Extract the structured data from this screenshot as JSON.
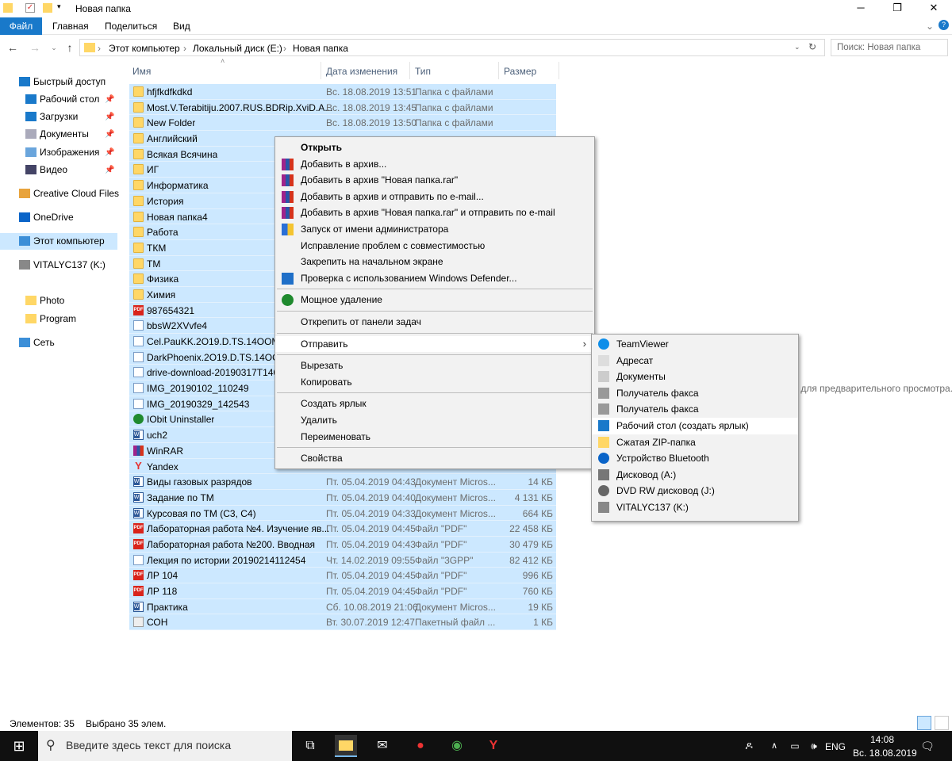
{
  "window": {
    "title": "Новая папка",
    "minimize": "─",
    "maximize": "❐",
    "close": "✕"
  },
  "ribbon": {
    "tabs": [
      "Файл",
      "Главная",
      "Поделиться",
      "Вид"
    ]
  },
  "address": {
    "crumbs": [
      "Этот компьютер",
      "Локальный диск (E:)",
      "Новая папка"
    ],
    "search_placeholder": "Поиск: Новая папка"
  },
  "sidebar": {
    "items": [
      {
        "label": "Быстрый доступ",
        "icon": "star-icon"
      },
      {
        "label": "Рабочий стол",
        "icon": "desktop-icon",
        "pinned": true
      },
      {
        "label": "Загрузки",
        "icon": "download-icon",
        "pinned": true
      },
      {
        "label": "Документы",
        "icon": "documents-icon",
        "pinned": true
      },
      {
        "label": "Изображения",
        "icon": "pictures-icon",
        "pinned": true
      },
      {
        "label": "Видео",
        "icon": "video-icon",
        "pinned": true
      },
      {
        "label": "Creative Cloud Files",
        "icon": "creative-cloud-icon"
      },
      {
        "label": "OneDrive",
        "icon": "onedrive-icon"
      },
      {
        "label": "Этот компьютер",
        "icon": "computer-icon",
        "selected": true
      },
      {
        "label": "VITALYC137 (K:)",
        "icon": "usb-drive-icon"
      },
      {
        "label": "Photo",
        "icon": "folder-icon"
      },
      {
        "label": "Program",
        "icon": "folder-icon"
      },
      {
        "label": "Сеть",
        "icon": "network-icon"
      }
    ]
  },
  "columns": {
    "name": "Имя",
    "date": "Дата изменения",
    "type": "Тип",
    "size": "Размер"
  },
  "files": [
    {
      "name": "hfjfkdfkdkd",
      "date": "Вс. 18.08.2019 13:51",
      "type": "Папка с файлами",
      "size": "",
      "icon": "folder"
    },
    {
      "name": "Most.V.Terabitiju.2007.RUS.BDRip.XviD.A...",
      "date": "Вс. 18.08.2019 13:45",
      "type": "Папка с файлами",
      "size": "",
      "icon": "folder"
    },
    {
      "name": "New Folder",
      "date": "Вс. 18.08.2019 13:50",
      "type": "Папка с файлами",
      "size": "",
      "icon": "folder"
    },
    {
      "name": "Английский",
      "date": "",
      "type": "",
      "size": "",
      "icon": "folder"
    },
    {
      "name": "Всякая Всячина",
      "date": "",
      "type": "",
      "size": "",
      "icon": "folder"
    },
    {
      "name": "ИГ",
      "date": "",
      "type": "",
      "size": "",
      "icon": "folder"
    },
    {
      "name": "Информатика",
      "date": "",
      "type": "",
      "size": "",
      "icon": "folder"
    },
    {
      "name": "История",
      "date": "",
      "type": "",
      "size": "",
      "icon": "folder"
    },
    {
      "name": "Новая папка4",
      "date": "",
      "type": "",
      "size": "",
      "icon": "folder"
    },
    {
      "name": "Работа",
      "date": "",
      "type": "",
      "size": "",
      "icon": "folder"
    },
    {
      "name": "ТКМ",
      "date": "",
      "type": "",
      "size": "",
      "icon": "folder"
    },
    {
      "name": "ТМ",
      "date": "",
      "type": "",
      "size": "",
      "icon": "folder"
    },
    {
      "name": "Физика",
      "date": "",
      "type": "",
      "size": "",
      "icon": "folder"
    },
    {
      "name": "Химия",
      "date": "",
      "type": "",
      "size": "",
      "icon": "folder"
    },
    {
      "name": "987654321",
      "date": "",
      "type": "",
      "size": "",
      "icon": "pdf"
    },
    {
      "name": "bbsW2XVvfe4",
      "date": "",
      "type": "",
      "size": "",
      "icon": "doc"
    },
    {
      "name": "Cel.PauKK.2O19.D.TS.14OOMB",
      "date": "",
      "type": "",
      "size": "",
      "icon": "doc"
    },
    {
      "name": "DarkPhoenix.2O19.D.TS.14OOMB",
      "date": "",
      "type": "",
      "size": "",
      "icon": "doc"
    },
    {
      "name": "drive-download-20190317T140600",
      "date": "",
      "type": "",
      "size": "",
      "icon": "doc"
    },
    {
      "name": "IMG_20190102_110249",
      "date": "",
      "type": "",
      "size": "",
      "icon": "doc"
    },
    {
      "name": "IMG_20190329_142543",
      "date": "",
      "type": "",
      "size": "",
      "icon": "doc"
    },
    {
      "name": "IObit Uninstaller",
      "date": "",
      "type": "",
      "size": "",
      "icon": "iobit"
    },
    {
      "name": "uch2",
      "date": "",
      "type": "",
      "size": "",
      "icon": "word"
    },
    {
      "name": "WinRAR",
      "date": "",
      "type": "",
      "size": "",
      "icon": "rar"
    },
    {
      "name": "Yandex",
      "date": "",
      "type": "",
      "size": "",
      "icon": "yandex"
    },
    {
      "name": "Виды газовых разрядов",
      "date": "Пт. 05.04.2019 04:43",
      "type": "Документ Micros...",
      "size": "14 КБ",
      "icon": "word"
    },
    {
      "name": "Задание по ТМ",
      "date": "Пт. 05.04.2019 04:40",
      "type": "Документ Micros...",
      "size": "4 131 КБ",
      "icon": "word"
    },
    {
      "name": "Курсовая по ТМ (С3, С4)",
      "date": "Пт. 05.04.2019 04:33",
      "type": "Документ Micros...",
      "size": "664 КБ",
      "icon": "word"
    },
    {
      "name": "Лабораторная работа №4. Изучение яв...",
      "date": "Пт. 05.04.2019 04:45",
      "type": "Файл \"PDF\"",
      "size": "22 458 КБ",
      "icon": "pdf"
    },
    {
      "name": "Лабораторная работа №200. Вводная",
      "date": "Пт. 05.04.2019 04:43",
      "type": "Файл \"PDF\"",
      "size": "30 479 КБ",
      "icon": "pdf"
    },
    {
      "name": "Лекция по истории 20190214112454",
      "date": "Чт. 14.02.2019 09:55",
      "type": "Файл \"3GPP\"",
      "size": "82 412 КБ",
      "icon": "doc"
    },
    {
      "name": "ЛР 104",
      "date": "Пт. 05.04.2019 04:45",
      "type": "Файл \"PDF\"",
      "size": "996 КБ",
      "icon": "pdf"
    },
    {
      "name": "ЛР 118",
      "date": "Пт. 05.04.2019 04:45",
      "type": "Файл \"PDF\"",
      "size": "760 КБ",
      "icon": "pdf"
    },
    {
      "name": "Практика",
      "date": "Сб. 10.08.2019 21:06",
      "type": "Документ Micros...",
      "size": "19 КБ",
      "icon": "word"
    },
    {
      "name": "СОН",
      "date": "Вт. 30.07.2019 12:47",
      "type": "Пакетный файл ...",
      "size": "1 КБ",
      "icon": "bat"
    }
  ],
  "preview_text": "х для предварительного просмотра.",
  "context_menu": [
    {
      "label": "Открыть",
      "bold": true
    },
    {
      "label": "Добавить в архив...",
      "icon": "winrar"
    },
    {
      "label": "Добавить в архив \"Новая папка.rar\"",
      "icon": "winrar"
    },
    {
      "label": "Добавить в архив и отправить по e-mail...",
      "icon": "winrar"
    },
    {
      "label": "Добавить в архив \"Новая папка.rar\" и отправить по e-mail",
      "icon": "winrar"
    },
    {
      "label": "Запуск от имени администратора",
      "icon": "shield"
    },
    {
      "label": "Исправление проблем с совместимостью"
    },
    {
      "label": "Закрепить на начальном экране"
    },
    {
      "label": "Проверка с использованием Windows Defender...",
      "icon": "defender"
    },
    {
      "sep": true
    },
    {
      "label": "Мощное удаление",
      "icon": "iobit"
    },
    {
      "sep": true
    },
    {
      "label": "Открепить от панели задач"
    },
    {
      "sep": true
    },
    {
      "label": "Отправить",
      "submenu": true,
      "hover": true
    },
    {
      "sep": true
    },
    {
      "label": "Вырезать"
    },
    {
      "label": "Копировать"
    },
    {
      "sep": true
    },
    {
      "label": "Создать ярлык"
    },
    {
      "label": "Удалить"
    },
    {
      "label": "Переименовать"
    },
    {
      "sep": true
    },
    {
      "label": "Свойства"
    }
  ],
  "send_to": [
    {
      "label": "TeamViewer",
      "icon": "teamviewer"
    },
    {
      "label": "Адресат",
      "icon": "mail"
    },
    {
      "label": "Документы",
      "icon": "documents"
    },
    {
      "label": "Получатель факса",
      "icon": "fax"
    },
    {
      "label": "Получатель факса",
      "icon": "fax"
    },
    {
      "label": "Рабочий стол (создать ярлык)",
      "icon": "desktop",
      "hover": true
    },
    {
      "label": "Сжатая ZIP-папка",
      "icon": "zip"
    },
    {
      "label": "Устройство Bluetooth",
      "icon": "bluetooth"
    },
    {
      "label": "Дисковод (A:)",
      "icon": "floppy"
    },
    {
      "label": "DVD RW дисковод (J:)",
      "icon": "dvd"
    },
    {
      "label": "VITALYC137 (K:)",
      "icon": "usb"
    }
  ],
  "status": {
    "count": "Элементов: 35",
    "selected": "Выбрано 35 элем."
  },
  "taskbar": {
    "search_placeholder": "Введите здесь текст для поиска",
    "lang": "ENG",
    "time": "14:08",
    "date": "Вс. 18.08.2019"
  },
  "colors": {
    "selection": "#cce8ff",
    "accent": "#1979ca",
    "taskbar": "#101010"
  }
}
